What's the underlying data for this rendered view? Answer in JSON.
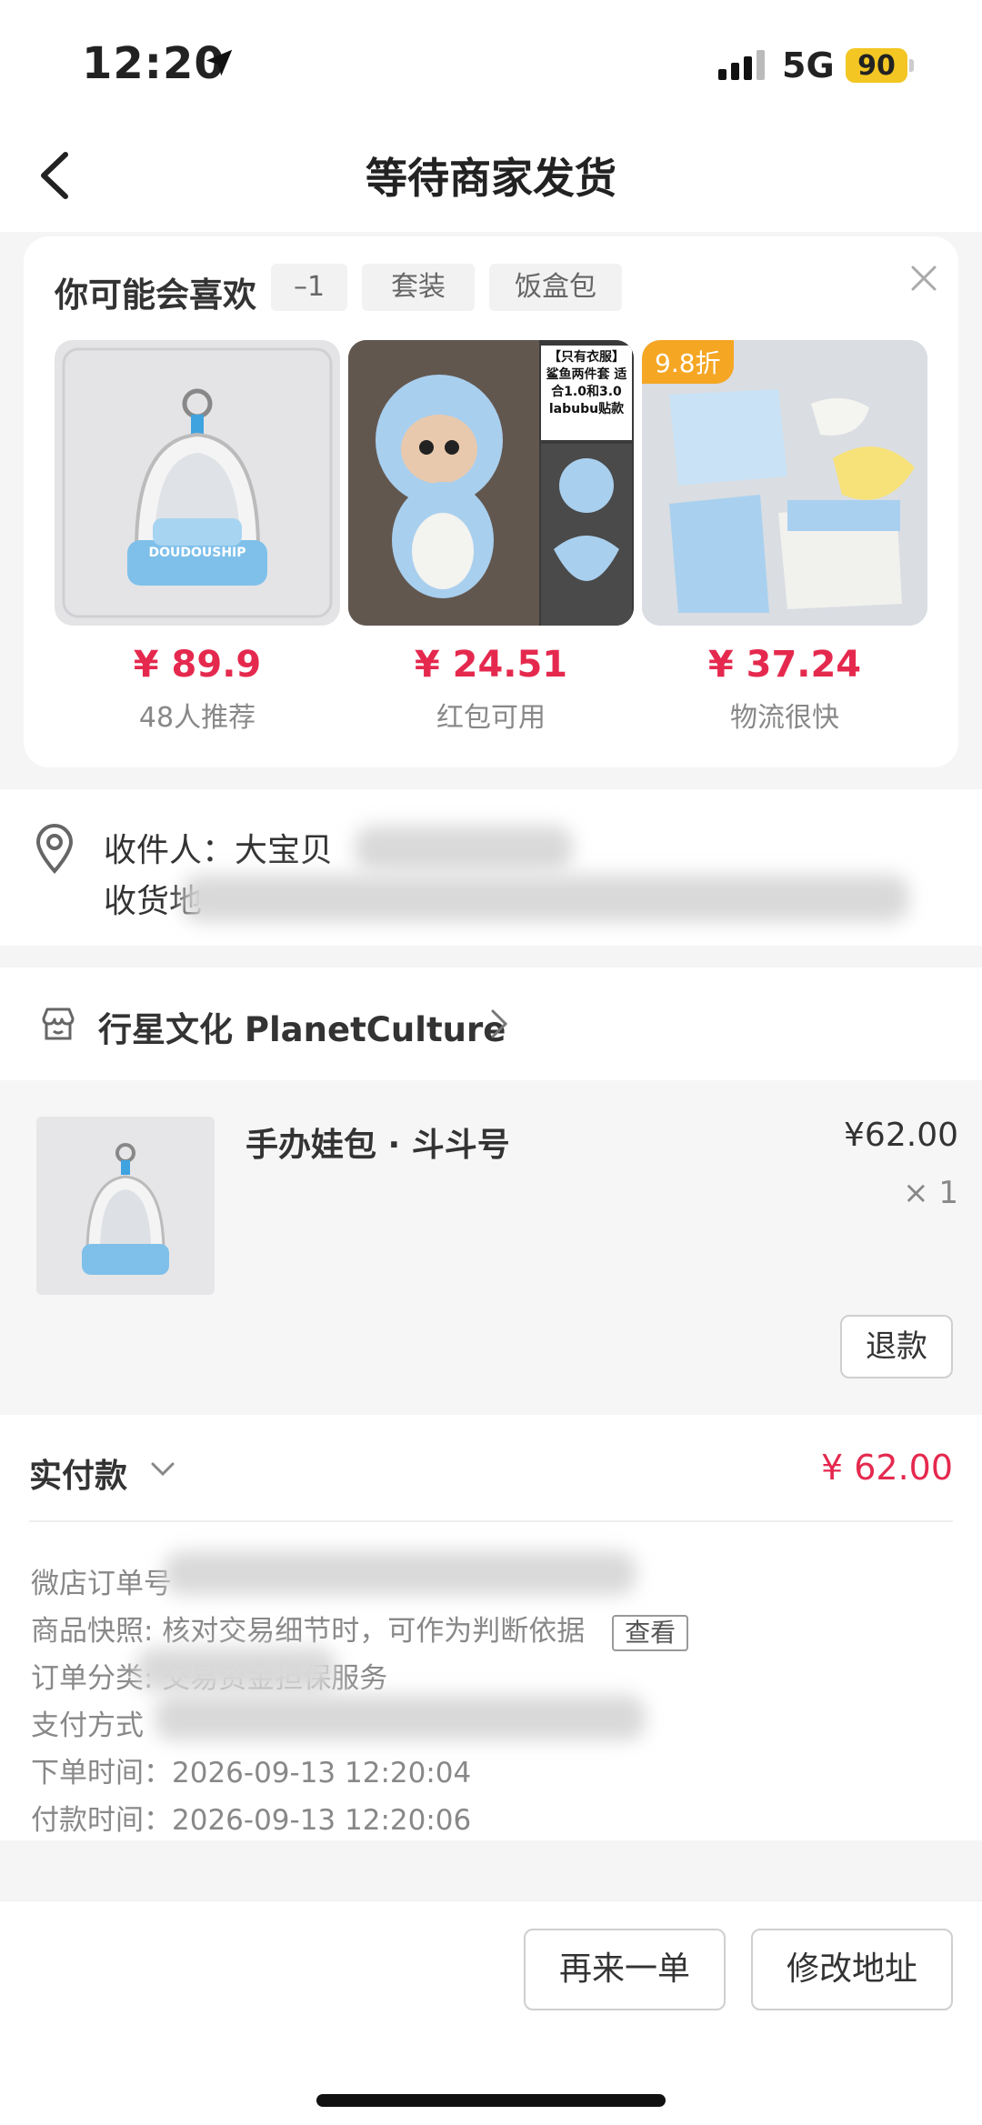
{
  "status_bar": {
    "time": "12:20",
    "network": "5G",
    "battery": "90"
  },
  "nav": {
    "title": "等待商家发货"
  },
  "recommend": {
    "title": "你可能会喜欢",
    "chips": [
      "–1",
      "套装",
      "饭盒包"
    ],
    "products": [
      {
        "price": "¥ 89.9",
        "sub": "48人推荐",
        "badge": "",
        "img_text": "DOUDOUSHIP"
      },
      {
        "price": "¥ 24.51",
        "sub": "红包可用",
        "badge": "",
        "img_text": "【只有衣服】 鲨鱼两件套 适合1.0和3.0 labubu贴款"
      },
      {
        "price": "¥ 37.24",
        "sub": "物流很快",
        "badge": "9.8折",
        "img_text": ""
      }
    ]
  },
  "address": {
    "recipient_label": "收件人：大宝贝",
    "address_label": "收货地"
  },
  "shop": {
    "name": "行星文化 PlanetCulture"
  },
  "order_item": {
    "name": "手办娃包 · 斗斗号",
    "price": "¥62.00",
    "qty": "× 1",
    "refund": "退款"
  },
  "payment": {
    "label": "实付款",
    "amount": "¥ 62.00",
    "rows": [
      {
        "text": "微店订单号"
      },
      {
        "text": "商品快照: 核对交易细节时，可作为判断依据",
        "button": "查看"
      },
      {
        "text": "订单分类: 交易资金担保服务"
      },
      {
        "text": "支付方式"
      },
      {
        "text": "下单时间：2026-09-13 12:20:04"
      },
      {
        "text": "付款时间：2026-09-13 12:20:06"
      }
    ]
  },
  "actions": {
    "reorder": "再来一单",
    "change_address": "修改地址"
  },
  "colors": {
    "price_red": "#e5294e",
    "badge_orange": "#f5a623",
    "battery_yellow": "#f3c623"
  }
}
